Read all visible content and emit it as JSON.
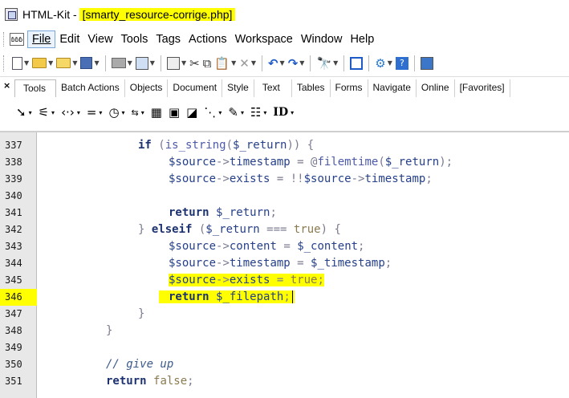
{
  "titlebar": {
    "app_name": "HTML-Kit - ",
    "file_name": "[smarty_resource-corrige.php]"
  },
  "menubar": {
    "icon_text": "ɓɓɓ",
    "items": [
      {
        "label": "File"
      },
      {
        "label": "Edit"
      },
      {
        "label": "View"
      },
      {
        "label": "Tools"
      },
      {
        "label": "Tags"
      },
      {
        "label": "Actions"
      },
      {
        "label": "Workspace"
      },
      {
        "label": "Window"
      },
      {
        "label": "Help"
      }
    ]
  },
  "toolbar": {
    "icons": [
      "new-file-icon",
      "open-folder-icon",
      "open-recent-icon",
      "save-icon",
      "print-icon",
      "publish-icon",
      "window-icon",
      "cut-icon",
      "copy-icon",
      "paste-icon",
      "delete-icon",
      "undo-icon",
      "redo-icon",
      "find-icon",
      "split-view-icon",
      "plugin-icon",
      "help-icon",
      "monitor-icon"
    ]
  },
  "panel": {
    "close_label": "×",
    "tabs": [
      {
        "label": "Tools"
      },
      {
        "label": "Batch Actions"
      },
      {
        "label": "Objects"
      },
      {
        "label": "Document"
      },
      {
        "label": "Style"
      },
      {
        "label": "Text"
      },
      {
        "label": "Tables"
      },
      {
        "label": "Forms"
      },
      {
        "label": "Navigate"
      },
      {
        "label": "Online"
      },
      {
        "label": "[Favorites]"
      }
    ],
    "tools_row": {
      "id_label": "ID",
      "arrow": "▾"
    }
  },
  "editor": {
    "line_numbers": [
      "337",
      "338",
      "339",
      "340",
      "341",
      "342",
      "343",
      "344",
      "345",
      "346",
      "347",
      "348",
      "349",
      "350",
      "351"
    ],
    "highlighted_line": "346",
    "lines": {
      "l337": {
        "kw": "if",
        "open": " (",
        "fn": "is_string",
        "p1": "(",
        "var": "$_return",
        "close": ")) {"
      },
      "l338": {
        "var1": "$source",
        "arrow": "->",
        "prop": "timestamp",
        "eq": " = ",
        "at": "@",
        "fn": "filemtime",
        "p1": "(",
        "var2": "$_return",
        "close": ");"
      },
      "l339": {
        "var1": "$source",
        "arrow": "->",
        "prop": "exists",
        "eq": " = ",
        "bang": "!!",
        "var2": "$source",
        "arrow2": "->",
        "prop2": "timestamp",
        "semi": ";"
      },
      "l341": {
        "kw": "return",
        "sp": " ",
        "var": "$_return",
        "semi": ";"
      },
      "l342": {
        "brace": "} ",
        "kw": "elseif",
        "open": " (",
        "var": "$_return",
        "eq": " === ",
        "lit": "true",
        "close": ") {"
      },
      "l343": {
        "var1": "$source",
        "arrow": "->",
        "prop": "content",
        "eq": " = ",
        "var2": "$_content",
        "semi": ";"
      },
      "l344": {
        "var1": "$source",
        "arrow": "->",
        "prop": "timestamp",
        "eq": " = ",
        "var2": "$_timestamp",
        "semi": ";"
      },
      "l345": {
        "var1": "$source",
        "arrow": "->",
        "prop": "exists",
        "eq": " = ",
        "lit": "true",
        "semi": ";"
      },
      "l346": {
        "kw": "return",
        "sp": " ",
        "var": "$_filepath",
        "semi": ";"
      },
      "l347": {
        "brace": "}"
      },
      "l348": {
        "brace": "}"
      },
      "l350": {
        "comment": "// give up"
      },
      "l351": {
        "kw": "return",
        "sp": " ",
        "lit": "false",
        "semi": ";"
      }
    }
  },
  "colors": {
    "highlight": "#ffff00",
    "gutter": "#e8e8e8",
    "code_text": "#1f3b73"
  }
}
